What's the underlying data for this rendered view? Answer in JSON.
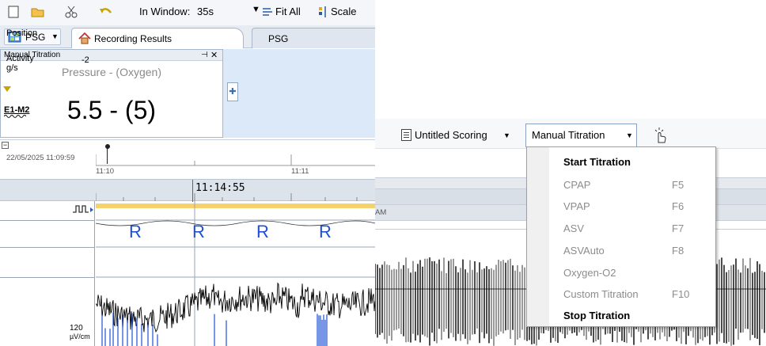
{
  "toolbar": {
    "in_window_label": "In Window:",
    "in_window_value": "35s",
    "fit_all_label": "Fit All",
    "scale_label": "Scale"
  },
  "tabs": {
    "psg_menu_label": "PSG",
    "recording_results_label": "Recording Results",
    "psg_tab_label": "PSG"
  },
  "manual_titration_panel": {
    "title": "Manual Titration",
    "subtitle": "Pressure - (Oxygen)",
    "value": "5.5 - (5)"
  },
  "timeline": {
    "date_time": "22/05/2025 11:09:59",
    "tick_1": "11:10",
    "tick_2": "11:11",
    "cursor_time": "11:14:55"
  },
  "channels": {
    "position_label": "Position",
    "activity_label": "Activity\ng/s",
    "activity_value": "-2",
    "e1_label": "E1-M2",
    "e1_scale_value": "120",
    "e1_scale_unit": "µV/cm",
    "position_markers": [
      "R",
      "R",
      "R",
      "R"
    ]
  },
  "right_toolbar": {
    "untitled_scoring_label": "Untitled Scoring",
    "manual_titration_label": "Manual Titration"
  },
  "right_timeline": {
    "am_label": "AM"
  },
  "menu": {
    "items": [
      {
        "label": "Start Titration",
        "shortcut": "",
        "enabled": true
      },
      {
        "label": "CPAP",
        "shortcut": "F5",
        "enabled": false
      },
      {
        "label": "VPAP",
        "shortcut": "F6",
        "enabled": false
      },
      {
        "label": "ASV",
        "shortcut": "F7",
        "enabled": false
      },
      {
        "label": "ASVAuto",
        "shortcut": "F8",
        "enabled": false
      },
      {
        "label": "Oxygen-O2",
        "shortcut": "",
        "enabled": false
      },
      {
        "label": "Custom Titration",
        "shortcut": "F10",
        "enabled": false
      },
      {
        "label": "Stop Titration",
        "shortcut": "",
        "enabled": true
      }
    ]
  },
  "colors": {
    "accent_blue": "#1e4fd6",
    "panel_blue": "#dbe9f9",
    "event_yellow": "#f5d26c"
  }
}
